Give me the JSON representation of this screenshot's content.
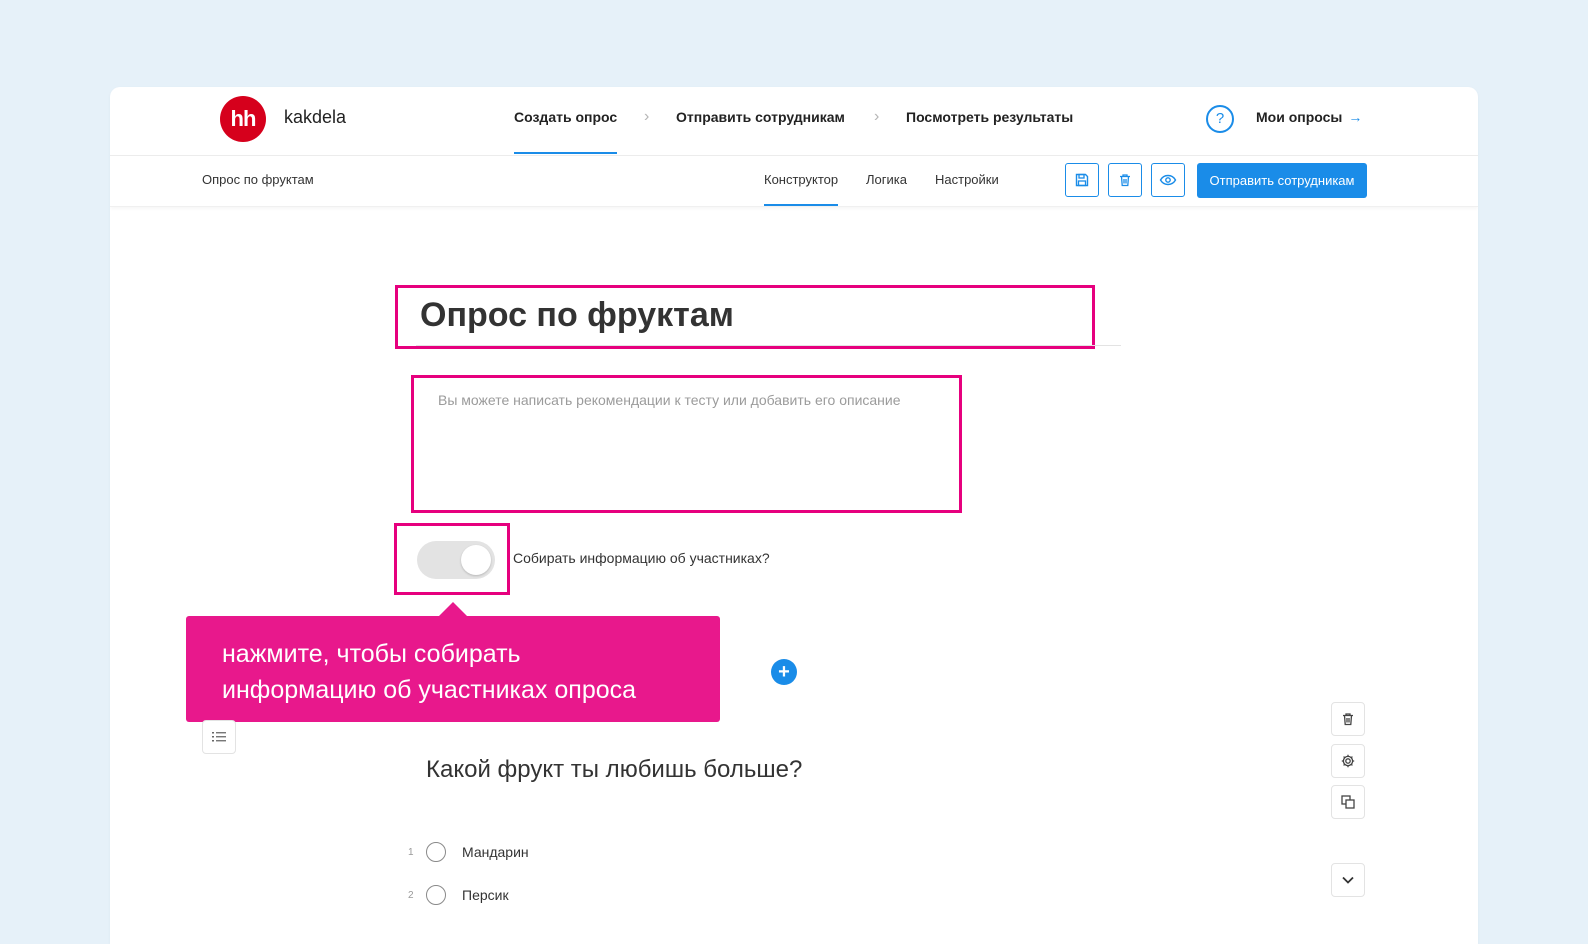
{
  "brand": {
    "logo_text": "hh",
    "name": "kakdela"
  },
  "steps": [
    {
      "label": "Создать опрос",
      "active": true
    },
    {
      "label": "Отправить сотрудникам",
      "active": false
    },
    {
      "label": "Посмотреть результаты",
      "active": false
    }
  ],
  "step_separator": "›",
  "help_label": "?",
  "my_surveys": {
    "label": "Мои опросы",
    "arrow": "→"
  },
  "subnav": {
    "survey_name": "Опрос по фруктам",
    "tabs": [
      "Конструктор",
      "Логика",
      "Настройки"
    ],
    "active_tab": "Конструктор",
    "send_button": "Отправить сотрудникам"
  },
  "editor": {
    "title": "Опрос по фруктам",
    "description_placeholder": "Вы можете написать рекомендации к тесту или добавить его описание",
    "collect_info_label": "Собирать информацию об участниках?",
    "collect_info_enabled": false
  },
  "callout": {
    "line1": "нажмите, чтобы собирать",
    "line2": "информацию об участниках опроса"
  },
  "add_icon": "+",
  "question": {
    "text": "Какой фрукт ты любишь больше?",
    "options": [
      {
        "num": "1",
        "label": "Мандарин"
      },
      {
        "num": "2",
        "label": "Персик"
      }
    ]
  },
  "colors": {
    "accent": "#1a8ce8",
    "highlight": "#e6007e",
    "callout": "#e8188c",
    "logo": "#d6001c",
    "background": "#e6f1f9"
  },
  "icons": {
    "toolbar": [
      "save-icon",
      "trash-icon",
      "eye-icon"
    ],
    "side": [
      "trash-icon",
      "gear-icon",
      "duplicate-icon",
      "chevron-down-icon"
    ]
  }
}
